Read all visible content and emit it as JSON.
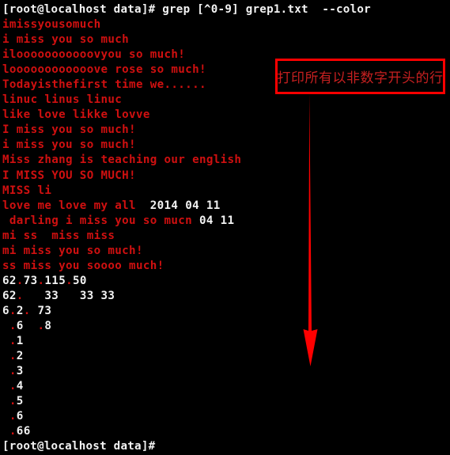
{
  "terminal": {
    "background_color": "#000000",
    "prompt_color": "#f2f2f2",
    "match_color": "#d01010",
    "command_line": "[root@localhost data]# grep [^0-9] grep1.txt  --color",
    "final_prompt": "[root@localhost data]#",
    "output_lines": [
      {
        "type": "plain",
        "text": "imissyousomuch"
      },
      {
        "type": "plain",
        "text": "i miss you so much"
      },
      {
        "type": "plain",
        "text": "ilooooooooooovyou so much!"
      },
      {
        "type": "plain",
        "text": "loooooooooooove rose so much!"
      },
      {
        "type": "plain",
        "text": "Todayisthefirst time we......"
      },
      {
        "type": "plain",
        "text": "linuc linus linuc"
      },
      {
        "type": "plain",
        "text": "like love likke lovve"
      },
      {
        "type": "plain",
        "text": "I miss you so much!"
      },
      {
        "type": "plain",
        "text": "i miss you so much!"
      },
      {
        "type": "plain",
        "text": "Miss zhang is teaching our english"
      },
      {
        "type": "plain",
        "text": "I MISS YOU SO MUCH!"
      },
      {
        "type": "plain",
        "text": "MISS li"
      },
      {
        "type": "mixed",
        "segments": [
          {
            "color": "red",
            "text": "love me love my all  "
          },
          {
            "color": "white",
            "text": "2014 04 11"
          }
        ]
      },
      {
        "type": "mixed",
        "segments": [
          {
            "color": "red",
            "text": " darling i miss you so mucn "
          },
          {
            "color": "white",
            "text": "04 11"
          }
        ]
      },
      {
        "type": "plain",
        "text": "mi ss  miss miss"
      },
      {
        "type": "plain",
        "text": "mi miss you so much!"
      },
      {
        "type": "plain",
        "text": "ss miss you soooo much!"
      },
      {
        "type": "mixed",
        "segments": [
          {
            "color": "white",
            "text": "62"
          },
          {
            "color": "red",
            "text": "."
          },
          {
            "color": "white",
            "text": "73"
          },
          {
            "color": "red",
            "text": "."
          },
          {
            "color": "white",
            "text": "115"
          },
          {
            "color": "red",
            "text": "."
          },
          {
            "color": "white",
            "text": "50"
          }
        ]
      },
      {
        "type": "mixed",
        "segments": [
          {
            "color": "white",
            "text": "62"
          },
          {
            "color": "red",
            "text": "."
          },
          {
            "color": "white",
            "text": "   33   33 33"
          }
        ]
      },
      {
        "type": "mixed",
        "segments": [
          {
            "color": "white",
            "text": "6"
          },
          {
            "color": "red",
            "text": "."
          },
          {
            "color": "white",
            "text": "2"
          },
          {
            "color": "red",
            "text": "."
          },
          {
            "color": "white",
            "text": " 73"
          }
        ]
      },
      {
        "type": "mixed",
        "segments": [
          {
            "color": "red",
            "text": " ."
          },
          {
            "color": "white",
            "text": "6"
          },
          {
            "color": "red",
            "text": "  ."
          },
          {
            "color": "white",
            "text": "8"
          }
        ]
      },
      {
        "type": "mixed",
        "segments": [
          {
            "color": "red",
            "text": " ."
          },
          {
            "color": "white",
            "text": "1"
          }
        ]
      },
      {
        "type": "mixed",
        "segments": [
          {
            "color": "red",
            "text": " ."
          },
          {
            "color": "white",
            "text": "2"
          }
        ]
      },
      {
        "type": "mixed",
        "segments": [
          {
            "color": "red",
            "text": " ."
          },
          {
            "color": "white",
            "text": "3"
          }
        ]
      },
      {
        "type": "mixed",
        "segments": [
          {
            "color": "red",
            "text": " ."
          },
          {
            "color": "white",
            "text": "4"
          }
        ]
      },
      {
        "type": "mixed",
        "segments": [
          {
            "color": "red",
            "text": " ."
          },
          {
            "color": "white",
            "text": "5"
          }
        ]
      },
      {
        "type": "mixed",
        "segments": [
          {
            "color": "red",
            "text": " ."
          },
          {
            "color": "white",
            "text": "6"
          }
        ]
      },
      {
        "type": "mixed",
        "segments": [
          {
            "color": "red",
            "text": " ."
          },
          {
            "color": "white",
            "text": "66"
          }
        ]
      }
    ]
  },
  "annotation": {
    "text": "打印所有以非数字开头的行",
    "box_color": "#fe0000",
    "text_color": "#c62020",
    "arrow_color": "#fe0000",
    "arrow_direction": "down"
  }
}
